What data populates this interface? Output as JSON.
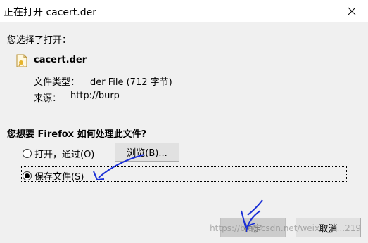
{
  "window": {
    "title": "正在打开 cacert.der"
  },
  "dialog": {
    "intro": "您选择了打开：",
    "file_name": "cacert.der",
    "type_label": "文件类型：",
    "type_value": "der File (712 字节)",
    "source_label": "来源：",
    "source_value": "http://burp",
    "question": "您想要 Firefox 如何处理此文件?",
    "option_open_label": "打开，通过(O)",
    "browse_label": "浏览(B)...",
    "option_save_label": "保存文件(S)",
    "selected_option": "save"
  },
  "footer": {
    "ok_label": "确定",
    "cancel_label": "取消"
  },
  "watermark": "https://blog.csdn.net/weixin_4...219",
  "colors": {
    "annotation": "#1a2fd6",
    "titlebar": "#ffffff",
    "dialog_bg": "#f0f0f0"
  },
  "icons": {
    "close": "close-icon",
    "file": "file-icon"
  }
}
